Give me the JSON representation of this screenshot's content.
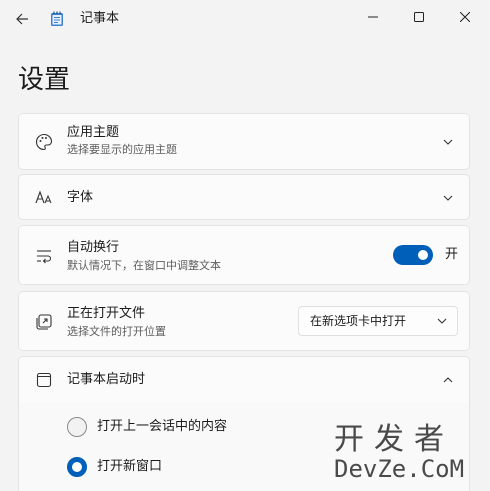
{
  "app": {
    "title": "记事本"
  },
  "page": {
    "title": "设置"
  },
  "settings": {
    "theme": {
      "label": "应用主题",
      "desc": "选择要显示的应用主题"
    },
    "font": {
      "label": "字体"
    },
    "wrap": {
      "label": "自动换行",
      "desc": "默认情况下，在窗口中调整文本",
      "state_label": "开",
      "enabled": true
    },
    "open_files": {
      "label": "正在打开文件",
      "desc": "选择文件的打开位置",
      "selected": "在新选项卡中打开"
    },
    "startup": {
      "label": "记事本启动时",
      "options": [
        {
          "label": "打开上一会话中的内容",
          "selected": false
        },
        {
          "label": "打开新窗口",
          "selected": true
        }
      ]
    }
  },
  "watermark": {
    "cn": "开发者",
    "en": "DevZe.CoM"
  },
  "colors": {
    "accent": "#005fb8",
    "background": "#f3f3f3",
    "card": "#fbfbfb"
  }
}
